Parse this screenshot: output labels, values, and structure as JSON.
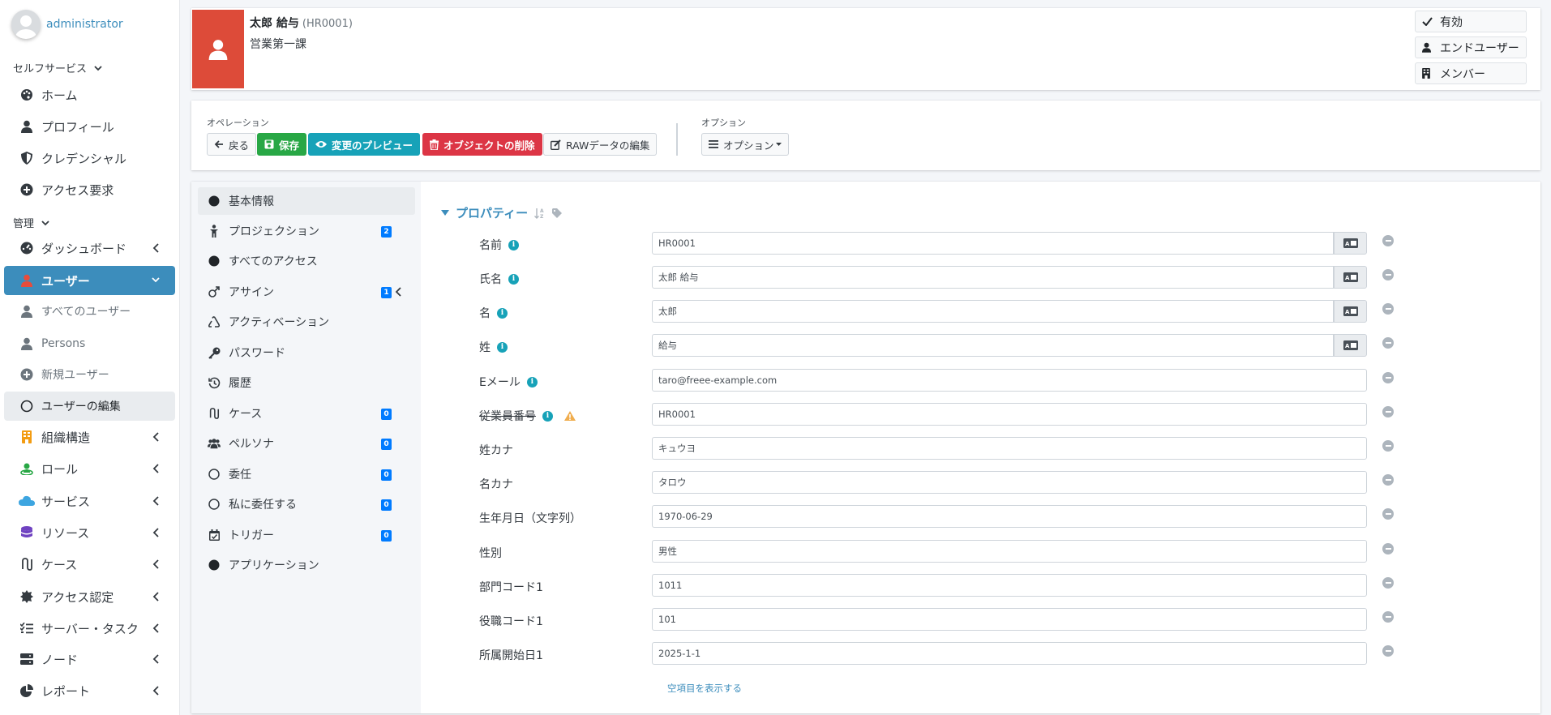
{
  "sidebar": {
    "user": "administrator",
    "selfservice_header": "セルフサービス",
    "selfservice_items": [
      {
        "label": "ホーム",
        "icon": "palette-icon"
      },
      {
        "label": "プロフィール",
        "icon": "user-icon"
      },
      {
        "label": "クレデンシャル",
        "icon": "shield-icon"
      },
      {
        "label": "アクセス要求",
        "icon": "plus-circle-icon"
      }
    ],
    "admin_header": "管理",
    "admin_items": [
      {
        "label": "ダッシュボード",
        "icon": "dashboard-icon"
      },
      {
        "label": "ユーザー",
        "icon": "user-icon"
      },
      {
        "label": "すべてのユーザー",
        "icon": "user-icon"
      },
      {
        "label": "Persons",
        "icon": "user-icon"
      },
      {
        "label": "新規ユーザー",
        "icon": "plus-circle-icon"
      },
      {
        "label": "ユーザーの編集",
        "icon": "circle-icon"
      },
      {
        "label": "組織構造",
        "icon": "building-icon"
      },
      {
        "label": "ロール",
        "icon": "role-icon"
      },
      {
        "label": "サービス",
        "icon": "cloud-icon"
      },
      {
        "label": "リソース",
        "icon": "database-icon"
      },
      {
        "label": "ケース",
        "icon": "case-icon"
      },
      {
        "label": "アクセス認定",
        "icon": "certificate-icon"
      },
      {
        "label": "サーバー・タスク",
        "icon": "tasks-icon"
      },
      {
        "label": "ノード",
        "icon": "server-icon"
      },
      {
        "label": "レポート",
        "icon": "chart-pie-icon"
      }
    ]
  },
  "header": {
    "name": "太郎 給与",
    "id": "(HR0001)",
    "dept": "営業第一課",
    "tags": [
      {
        "label": "有効",
        "icon": "check-icon"
      },
      {
        "label": "エンドユーザー",
        "icon": "user-icon"
      },
      {
        "label": "メンバー",
        "icon": "building-icon"
      }
    ]
  },
  "operations": {
    "label": "オペレーション",
    "back": "戻る",
    "save": "保存",
    "preview": "変更のプレビュー",
    "delete": "オブジェクトの削除",
    "raw": "RAWデータの編集",
    "options_label": "オプション",
    "options_button": "オプション"
  },
  "tabs": [
    {
      "label": "基本情報",
      "icon": "circle-filled-icon",
      "badge": ""
    },
    {
      "label": "プロジェクション",
      "icon": "child-icon",
      "badge": "2"
    },
    {
      "label": "すべてのアクセス",
      "icon": "circle-filled-icon",
      "badge": ""
    },
    {
      "label": "アサイン",
      "icon": "mars-icon",
      "badge": "1"
    },
    {
      "label": "アクティベーション",
      "icon": "recycle-icon",
      "badge": ""
    },
    {
      "label": "パスワード",
      "icon": "key-icon",
      "badge": ""
    },
    {
      "label": "履歴",
      "icon": "history-icon",
      "badge": ""
    },
    {
      "label": "ケース",
      "icon": "case-icon",
      "badge": "0"
    },
    {
      "label": "ペルソナ",
      "icon": "users-icon",
      "badge": "0"
    },
    {
      "label": "委任",
      "icon": "circle-icon",
      "badge": "0"
    },
    {
      "label": "私に委任する",
      "icon": "circle-icon",
      "badge": "0"
    },
    {
      "label": "トリガー",
      "icon": "calendar-icon",
      "badge": "0"
    },
    {
      "label": "アプリケーション",
      "icon": "circle-filled-icon",
      "badge": ""
    }
  ],
  "properties": {
    "title": "プロパティー",
    "fields": [
      {
        "label": "名前",
        "value": "HR0001"
      },
      {
        "label": "氏名",
        "value": "太郎 給与"
      },
      {
        "label": "名",
        "value": "太郎"
      },
      {
        "label": "姓",
        "value": "給与"
      },
      {
        "label": "Eメール",
        "value": "taro@freee-example.com"
      },
      {
        "label": "従業員番号",
        "value": "HR0001"
      },
      {
        "label": "姓カナ",
        "value": "キュウヨ"
      },
      {
        "label": "名カナ",
        "value": "タロウ"
      },
      {
        "label": "生年月日（文字列）",
        "value": "1970-06-29"
      },
      {
        "label": "性別",
        "value": "男性"
      },
      {
        "label": "部門コード1",
        "value": "1011"
      },
      {
        "label": "役職コード1",
        "value": "101"
      },
      {
        "label": "所属開始日1",
        "value": "2025-1-1"
      }
    ],
    "show_empty": "空項目を表示する"
  },
  "colors": {
    "accent": "#3c8dbc",
    "header_icon_bg": "#dd4b39",
    "success": "#28a745",
    "info": "#17a2b8",
    "danger": "#dc3545",
    "badge": "#007bff"
  }
}
